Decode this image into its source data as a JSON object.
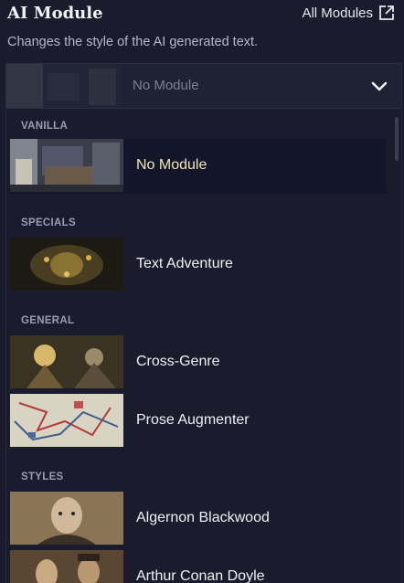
{
  "header": {
    "title": "AI Module",
    "all_modules_label": "All Modules",
    "subtitle": "Changes the style of the AI generated text."
  },
  "select": {
    "current_value": "No Module"
  },
  "sections": [
    {
      "label": "Vanilla"
    },
    {
      "label": "Specials"
    },
    {
      "label": "General"
    },
    {
      "label": "Styles"
    }
  ],
  "options": [
    {
      "label": "No Module",
      "selected": true,
      "thumb": "room-icon"
    },
    {
      "label": "Text Adventure",
      "selected": false,
      "thumb": "dungeon-icon"
    },
    {
      "label": "Cross-Genre",
      "selected": false,
      "thumb": "wizard-icon"
    },
    {
      "label": "Prose Augmenter",
      "selected": false,
      "thumb": "map-icon"
    },
    {
      "label": "Algernon Blackwood",
      "selected": false,
      "thumb": "portrait-icon"
    },
    {
      "label": "Arthur Conan Doyle",
      "selected": false,
      "thumb": "portrait-icon"
    }
  ],
  "colors": {
    "background": "#1a1c2e",
    "selected_text": "#f5e6b8",
    "placeholder_text": "#7e8095"
  }
}
